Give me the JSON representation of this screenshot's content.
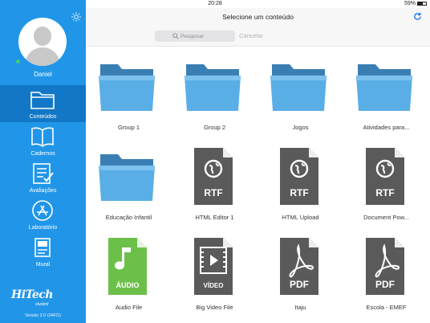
{
  "status_bar": {
    "device": "iPad",
    "time": "20:28",
    "battery": "59%"
  },
  "sidebar": {
    "user_name": "Daniel",
    "nav": [
      {
        "label": "Conteúdos",
        "icon": "folder-icon",
        "active": true
      },
      {
        "label": "Cadernos",
        "icon": "book-icon",
        "active": false
      },
      {
        "label": "Avaliações",
        "icon": "checklist-icon",
        "active": false
      },
      {
        "label": "Laboratório",
        "icon": "app-store-icon",
        "active": false
      },
      {
        "label": "Mural",
        "icon": "bulletin-icon",
        "active": false
      }
    ],
    "brand": "HiTech",
    "brand_sub": "student",
    "version": "Versão 2.0 (04FD)"
  },
  "header": {
    "title": "Selecione um conteúdo"
  },
  "search": {
    "placeholder": "Pesquisar",
    "cancel_label": "Cancelar"
  },
  "items": [
    {
      "label": "Group 1",
      "type": "folder"
    },
    {
      "label": "Group 2",
      "type": "folder"
    },
    {
      "label": "Jogos",
      "type": "folder"
    },
    {
      "label": "Atividades para...",
      "type": "folder"
    },
    {
      "label": "Educação Infantil",
      "type": "folder"
    },
    {
      "label": "HTML Editor 1",
      "type": "rtf",
      "badge": "RTF"
    },
    {
      "label": "HTML Upload",
      "type": "rtf",
      "badge": "RTF"
    },
    {
      "label": "Document Pow...",
      "type": "rtf",
      "badge": "RTF"
    },
    {
      "label": "Audio File",
      "type": "audio",
      "badge": "ÁUDIO"
    },
    {
      "label": "Big Video File",
      "type": "video",
      "badge": "VÍDEO"
    },
    {
      "label": "Itaju",
      "type": "pdf",
      "badge": "PDF"
    },
    {
      "label": "Escola - EMEF",
      "type": "pdf",
      "badge": "PDF"
    }
  ],
  "colors": {
    "sidebar": "#2196e8",
    "sidebar_active": "#1277c6",
    "folder": "#5aaee6",
    "doc": "#5a5a5a",
    "audio": "#6cc04a",
    "accent": "#1a73e8"
  }
}
